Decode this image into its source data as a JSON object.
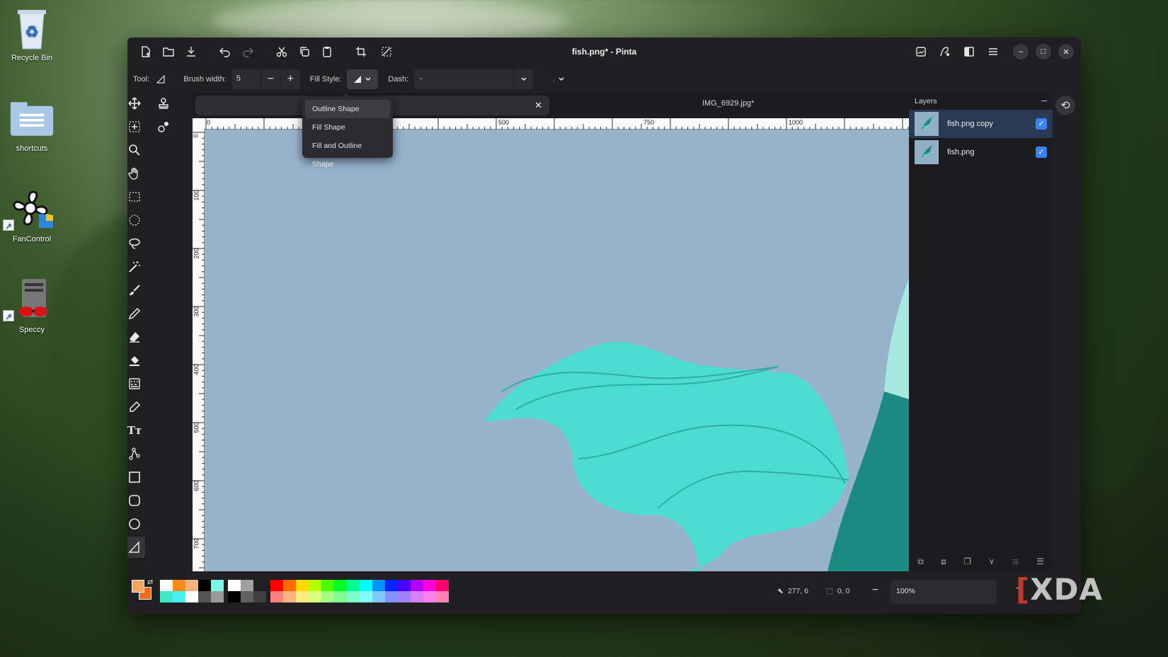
{
  "desktop": {
    "icons": [
      {
        "label": "Recycle Bin",
        "icon": "recycle-bin-icon"
      },
      {
        "label": "shortcuts",
        "icon": "folder-icon"
      },
      {
        "label": "FanControl",
        "icon": "fan-icon"
      },
      {
        "label": "Speccy",
        "icon": "speccy-icon"
      }
    ]
  },
  "window": {
    "title": "fish.png* - Pinta",
    "header_buttons": [
      "new-image",
      "open",
      "save",
      "undo",
      "redo",
      "cut",
      "copy",
      "paste",
      "crop",
      "deselect"
    ],
    "right_buttons": [
      "image-menu",
      "adjustments",
      "effects",
      "main-menu"
    ]
  },
  "toolbar": {
    "tool_label": "Tool:",
    "brush_width_label": "Brush width:",
    "brush_width_value": "5",
    "fill_style_label": "Fill Style:",
    "dash_label": "Dash:",
    "dash_value": "-"
  },
  "fill_style_menu": {
    "items": [
      "Outline Shape",
      "Fill Shape",
      "Fill and Outline Shape"
    ],
    "hovered": "Outline Shape"
  },
  "tabs": {
    "second_tab": "IMG_6929.jpg*"
  },
  "rulers": {
    "horizontal": [
      "0",
      "500",
      "750",
      "1000"
    ],
    "vertical": [
      "0",
      "100",
      "200",
      "300",
      "400",
      "500",
      "600",
      "700"
    ]
  },
  "layers": {
    "title": "Layers",
    "items": [
      {
        "name": "fish.png copy",
        "visible": true,
        "selected": true
      },
      {
        "name": "fish.png",
        "visible": true,
        "selected": false
      }
    ]
  },
  "status": {
    "cursor_pos": "277, 6",
    "selection_size": "0, 0",
    "zoom": "100%"
  },
  "colors": {
    "primary": "#f7a35c",
    "secondary": "#f26b1d",
    "canvas_bg": "#97b3cc",
    "fin": "#4ddcd2",
    "body_dark": "#1b8a80",
    "body_light": "#a6e8e0"
  },
  "watermark": "XDA"
}
